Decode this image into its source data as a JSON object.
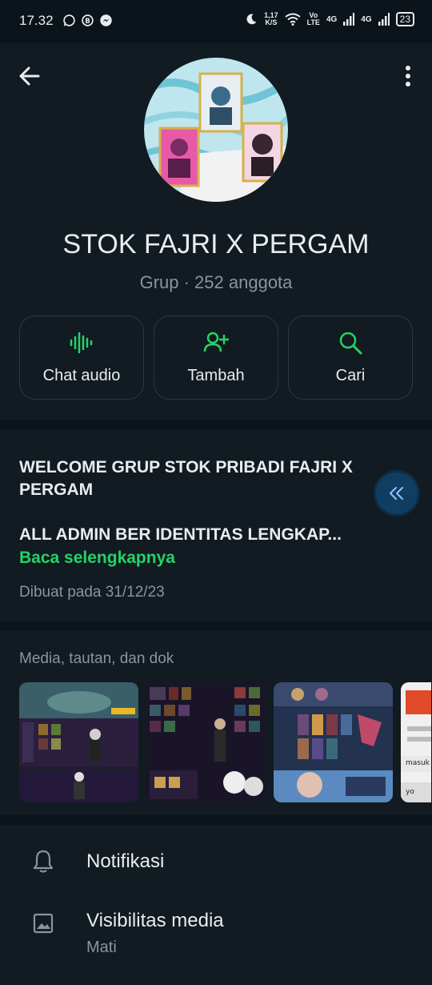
{
  "status_bar": {
    "time": "17.32",
    "speed_value": "1,17",
    "speed_unit": "K/S",
    "vo": "Vo",
    "lte": "LTE",
    "net1": "4G",
    "net2": "4G",
    "battery": "23",
    "left_icons": [
      "whatsapp-icon",
      "business-icon",
      "messenger-icon"
    ]
  },
  "header": {
    "group_name": "STOK FAJRI X PERGAM",
    "group_meta": "Grup · 252 anggota"
  },
  "actions": [
    {
      "label": "Chat audio",
      "icon": "audio-wave-icon"
    },
    {
      "label": "Tambah",
      "icon": "add-person-icon"
    },
    {
      "label": "Cari",
      "icon": "search-icon"
    }
  ],
  "description": {
    "line1": "WELCOME GRUP STOK PRIBADI FAJRI X PERGAM",
    "line2": "ALL ADMIN BER IDENTITAS LENGKAP...",
    "read_more": "Baca selengkapnya",
    "created": "Dibuat pada 31/12/23"
  },
  "media": {
    "title": "Media, tautan, dan dok",
    "thumb4_text1": "masuk",
    "thumb4_text2": "yo"
  },
  "settings": [
    {
      "label": "Notifikasi",
      "icon": "bell-icon"
    },
    {
      "label": "Visibilitas media",
      "sub": "Mati",
      "icon": "image-icon"
    }
  ],
  "colors": {
    "accent": "#25d366",
    "background": "#0b141a",
    "surface": "#111b21",
    "secondary_text": "#8696a0"
  }
}
